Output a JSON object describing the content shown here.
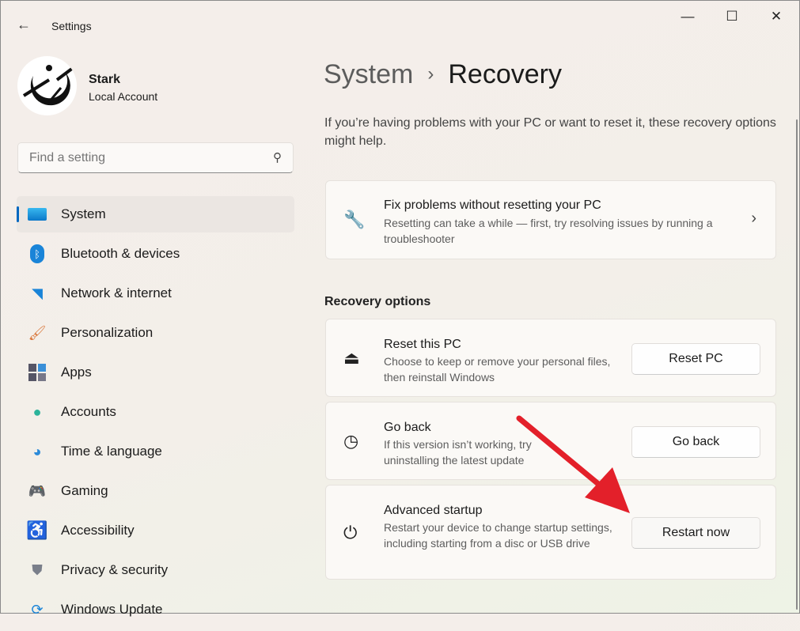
{
  "window": {
    "title": "Settings",
    "back": "←",
    "minimize": "—",
    "maximize": "☐",
    "close": "✕"
  },
  "user": {
    "name": "Stark",
    "account_type": "Local Account"
  },
  "search": {
    "placeholder": "Find a setting"
  },
  "sidebar": {
    "items": [
      {
        "label": "System",
        "selected": true
      },
      {
        "label": "Bluetooth & devices"
      },
      {
        "label": "Network & internet"
      },
      {
        "label": "Personalization"
      },
      {
        "label": "Apps"
      },
      {
        "label": "Accounts"
      },
      {
        "label": "Time & language"
      },
      {
        "label": "Gaming"
      },
      {
        "label": "Accessibility"
      },
      {
        "label": "Privacy & security"
      },
      {
        "label": "Windows Update"
      }
    ]
  },
  "breadcrumb": {
    "parent": "System",
    "separator": "›",
    "current": "Recovery"
  },
  "intro": "If you’re having problems with your PC or want to reset it, these recovery options might help.",
  "fix_card": {
    "title": "Fix problems without resetting your PC",
    "desc": "Resetting can take a while — first, try resolving issues by running a troubleshooter"
  },
  "section_label": "Recovery options",
  "options": [
    {
      "title": "Reset this PC",
      "desc": "Choose to keep or remove your personal files, then reinstall Windows",
      "button": "Reset PC"
    },
    {
      "title": "Go back",
      "desc": "If this version isn’t working, try uninstalling the latest update",
      "button": "Go back"
    },
    {
      "title": "Advanced startup",
      "desc": "Restart your device to change startup settings, including starting from a disc or USB drive",
      "button": "Restart now"
    }
  ],
  "colors": {
    "accent": "#0067c0",
    "annotation_arrow": "#e3202a"
  }
}
